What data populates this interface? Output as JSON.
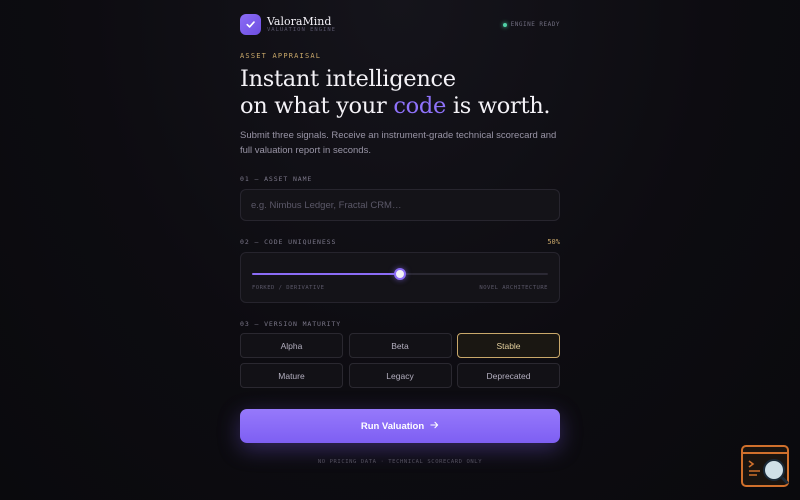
{
  "brand": {
    "name": "ValoraMind",
    "subtitle": "VALUATION ENGINE"
  },
  "status": {
    "text": "ENGINE READY",
    "color": "#4fd0a6"
  },
  "hero": {
    "eyebrow": "ASSET APPRAISAL",
    "line1": "Instant intelligence",
    "line2_pre": "on what your ",
    "line2_accent": "code",
    "line2_post": " is worth.",
    "description": "Submit three signals. Receive an instrument-grade technical scorecard and full valuation report in seconds."
  },
  "asset": {
    "label": "01 — ASSET NAME",
    "placeholder": "e.g. Nimbus Ledger, Fractal CRM…",
    "value": ""
  },
  "uniqueness": {
    "label": "02 — CODE UNIQUENESS",
    "value_text": "50%",
    "value": 50,
    "left_label": "FORKED / DERIVATIVE",
    "right_label": "NOVEL ARCHITECTURE"
  },
  "maturity": {
    "label": "03 — VERSION MATURITY",
    "options": [
      "Alpha",
      "Beta",
      "Stable",
      "Mature",
      "Legacy",
      "Deprecated"
    ],
    "selected": "Stable"
  },
  "cta": {
    "label": "Run Valuation",
    "icon": "arrow-right-icon"
  },
  "footnote": "NO PRICING DATA · TECHNICAL SCORECARD ONLY",
  "colors": {
    "accent": "#8b6cf6",
    "gold": "#c9a86a",
    "background": "#0d0c11"
  },
  "widget": {
    "icon": "code-search-icon"
  }
}
